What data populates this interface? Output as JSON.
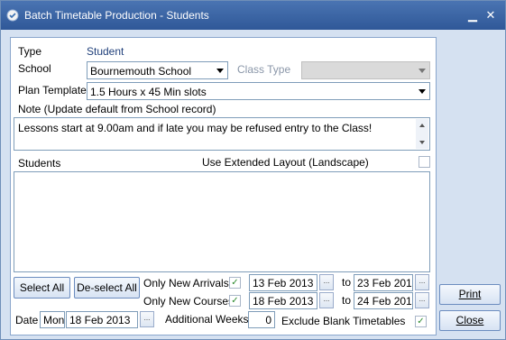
{
  "window": {
    "title": "Batch Timetable Production - Students",
    "minimize_glyph": "▁",
    "close_glyph": "✕"
  },
  "form": {
    "type_label": "Type",
    "type_value": "Student",
    "school_label": "School",
    "school_value": "Bournemouth School",
    "class_type_label": "Class Type",
    "class_type_value": "",
    "plan_template_label": "Plan Template",
    "plan_template_value": "1.5 Hours x 45 Min slots",
    "note_label": "Note (Update default from School record)",
    "note_value": "Lessons start at 9.00am and if late you may be refused entry to the Class!",
    "students_label": "Students",
    "extended_layout_label": "Use Extended Layout (Landscape)",
    "extended_layout_checked": "",
    "select_all_label": "Select All",
    "deselect_all_label": "De-select All",
    "only_new_arrivals_label": "Only New Arrivals",
    "only_new_arrivals_checked": "✓",
    "arrivals_from": "13 Feb 2013",
    "arrivals_to_label": "to",
    "arrivals_to": "23 Feb 201",
    "only_new_courses_label": "Only New Courses",
    "only_new_courses_checked": "✓",
    "courses_from": "18 Feb 2013",
    "courses_to_label": "to",
    "courses_to": "24 Feb 201",
    "date_label": "Date",
    "date_day": "Mon",
    "date_value": "18 Feb 2013",
    "additional_weeks_label": "Additional Weeks",
    "additional_weeks_value": "0",
    "exclude_blank_label": "Exclude Blank Timetables",
    "exclude_blank_checked": "✓",
    "ellipsis": "..."
  },
  "actions": {
    "print_label": "Print",
    "close_label": "Close"
  },
  "colors": {
    "titlebar": "#2f5898",
    "frame": "#d5e1f1",
    "panel_border": "#8aa6cc",
    "check": "#2d8a2d"
  }
}
